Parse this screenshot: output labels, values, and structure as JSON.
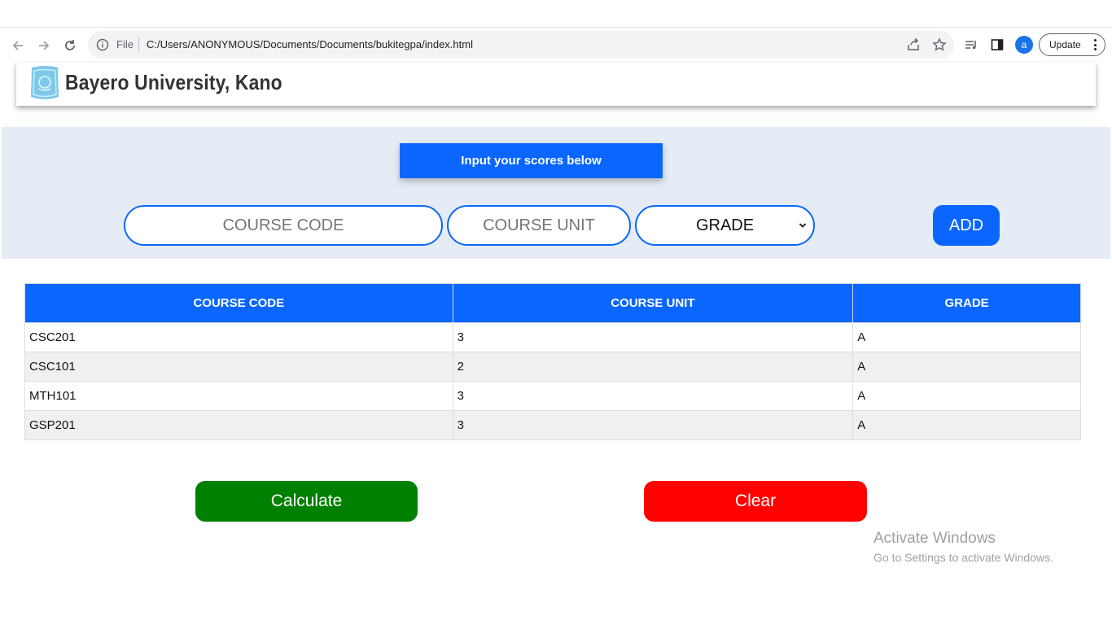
{
  "browser": {
    "scheme_label": "File",
    "url": "C:/Users/ANONYMOUS/Documents/Documents/bukitegpa/index.html",
    "profile_initial": "a",
    "update_label": "Update"
  },
  "header": {
    "brand": "Bayero University, Kano"
  },
  "input_panel": {
    "title": "Input your scores below",
    "course_code_placeholder": "COURSE CODE",
    "course_unit_placeholder": "COURSE UNIT",
    "grade_selected": "GRADE",
    "add_label": "ADD"
  },
  "table": {
    "headers": [
      "COURSE CODE",
      "COURSE UNIT",
      "GRADE"
    ],
    "rows": [
      [
        "CSC201",
        "3",
        "A"
      ],
      [
        "CSC101",
        "2",
        "A"
      ],
      [
        "MTH101",
        "3",
        "A"
      ],
      [
        "GSP201",
        "3",
        "A"
      ]
    ]
  },
  "actions": {
    "calculate_label": "Calculate",
    "clear_label": "Clear"
  },
  "watermark": {
    "title": "Activate Windows",
    "subtitle": "Go to Settings to activate Windows."
  },
  "colors": {
    "accent": "#0a66ff",
    "calculate": "#008000",
    "clear": "#ff0000",
    "panel_bg": "#e6ecf6"
  }
}
